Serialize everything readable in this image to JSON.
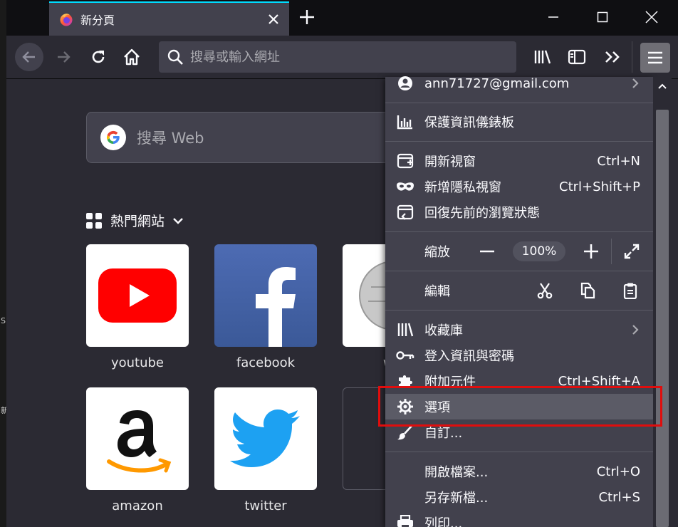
{
  "desktop": {
    "edge_letters": [
      "S",
      "新"
    ]
  },
  "tab": {
    "title": "新分頁",
    "close_label": "×"
  },
  "urlbar": {
    "placeholder": "搜尋或輸入網址"
  },
  "newtab": {
    "search_placeholder": "搜尋 Web",
    "top_sites_heading": "熱門網站"
  },
  "top_sites": [
    {
      "label": "youtube"
    },
    {
      "label": "facebook"
    },
    {
      "label": "wik"
    },
    {
      "label": "amazon"
    },
    {
      "label": "twitter"
    }
  ],
  "menu": {
    "account": "ann71727@gmail.com",
    "protections": "保護資訊儀錶板",
    "new_window": {
      "label": "開新視窗",
      "shortcut": "Ctrl+N"
    },
    "private_window": {
      "label": "新增隱私視窗",
      "shortcut": "Ctrl+Shift+P"
    },
    "restore_session": "回復先前的瀏覽狀態",
    "zoom": {
      "label": "縮放",
      "value": "100%"
    },
    "edit": {
      "label": "編輯"
    },
    "library": "收藏庫",
    "logins": "登入資訊與密碼",
    "addons": {
      "label": "附加元件",
      "shortcut": "Ctrl+Shift+A"
    },
    "options": "選項",
    "customize": "自訂...",
    "open_file": {
      "label": "開啟檔案...",
      "shortcut": "Ctrl+O"
    },
    "save_as": {
      "label": "另存新檔...",
      "shortcut": "Ctrl+S"
    },
    "print": "列印..."
  },
  "colors": {
    "accent_tab_line": "#00ddff",
    "highlight_box": "#e00d0d",
    "menu_bg": "#42414d"
  }
}
